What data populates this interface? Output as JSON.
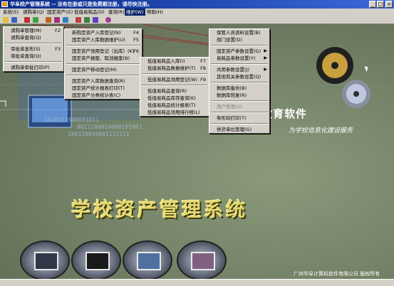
{
  "window": {
    "title": "华阜校产管理系统 -- 没有在册或只是免费期注册，请尽快注册。"
  },
  "menubar": {
    "items": [
      {
        "label": "系统(S)"
      },
      {
        "label": "请购单(Q)"
      },
      {
        "label": "固定资产(G)"
      },
      {
        "label": "低值易耗品(D)"
      },
      {
        "label": "查询(R)"
      },
      {
        "label": "维护(W)"
      },
      {
        "label": "帮助(H)"
      }
    ]
  },
  "menu_qinggou": {
    "items": [
      {
        "label": "请购单管理(M)",
        "shortcut": "F2"
      },
      {
        "label": "请购单查询(Q)",
        "shortcut": ""
      },
      {
        "label": "审批单发布(S)",
        "shortcut": "F3"
      },
      {
        "label": "审批单查询(Q)",
        "shortcut": ""
      },
      {
        "label": "请购单审批打印(P)",
        "shortcut": ""
      }
    ]
  },
  "menu_guding": {
    "items": [
      {
        "label": "新购定资产入库登记(N)",
        "shortcut": "F4"
      },
      {
        "label": "固定资产入库数据维护(U)",
        "shortcut": "F5"
      },
      {
        "label": "固定资产领用登记（出库）(K)",
        "shortcut": "F6"
      },
      {
        "label": "固定资产报废、取消报废(B)",
        "shortcut": ""
      },
      {
        "label": "固定资产移动登记(M)",
        "shortcut": ""
      },
      {
        "label": "固定资产入库数据查询(R)",
        "shortcut": ""
      },
      {
        "label": "固定资产统计报表打印(T)",
        "shortcut": ""
      },
      {
        "label": "固定资产分类统计表(C)",
        "shortcut": ""
      }
    ]
  },
  "menu_dizhi": {
    "items": [
      {
        "label": "低值易耗品入库(I)",
        "shortcut": "F7"
      },
      {
        "label": "低值易耗品数据维护(T)",
        "shortcut": "F8"
      },
      {
        "label": "低值易耗品领用登记(W)",
        "shortcut": "F9"
      },
      {
        "label": "低值易耗品查询(R)",
        "shortcut": ""
      },
      {
        "label": "低值易耗品库存查询(K)",
        "shortcut": ""
      },
      {
        "label": "低值易耗品统计报表(T)",
        "shortcut": ""
      },
      {
        "label": "低值易耗品领用排行榜(L)",
        "shortcut": ""
      }
    ]
  },
  "menu_weihu": {
    "items": [
      {
        "label": "保管人员资料设置(B)",
        "submenu": false,
        "disabled": false
      },
      {
        "label": "部门设置(D)",
        "submenu": false,
        "disabled": false
      },
      {
        "label": "固定资产参数设置(G)",
        "submenu": true,
        "disabled": false
      },
      {
        "label": "易耗品参数设置(Y)",
        "submenu": true,
        "disabled": false
      },
      {
        "label": "共用参数设置(J)",
        "submenu": true,
        "disabled": false
      },
      {
        "label": "其他有关参数设置(Q)",
        "submenu": false,
        "disabled": false
      },
      {
        "label": "数据库备份(B)",
        "submenu": false,
        "disabled": false
      },
      {
        "label": "数据库恢复(R)",
        "submenu": false,
        "disabled": false
      },
      {
        "label": "用户管理(U)",
        "submenu": false,
        "disabled": true
      },
      {
        "label": "条形码打印(T)",
        "submenu": false,
        "disabled": false
      },
      {
        "label": "供货单位管理(G)",
        "submenu": false,
        "disabled": false
      }
    ]
  },
  "banner": {
    "company": "华阜教育软件",
    "slogan": "为学校信息化建设服务",
    "title": "学校资产管理系统",
    "footer_company": "广州华阜计算机软件有限公司 版权所有",
    "digits_line1": "1010111000001011",
    "digits_line2": "0011100010000101001",
    "digits_line3": "100110010001111111"
  },
  "colors": {
    "title_bar": "#0a2a8a",
    "title_text": "#e6d870",
    "menu_bg": "#d4d0c8"
  }
}
